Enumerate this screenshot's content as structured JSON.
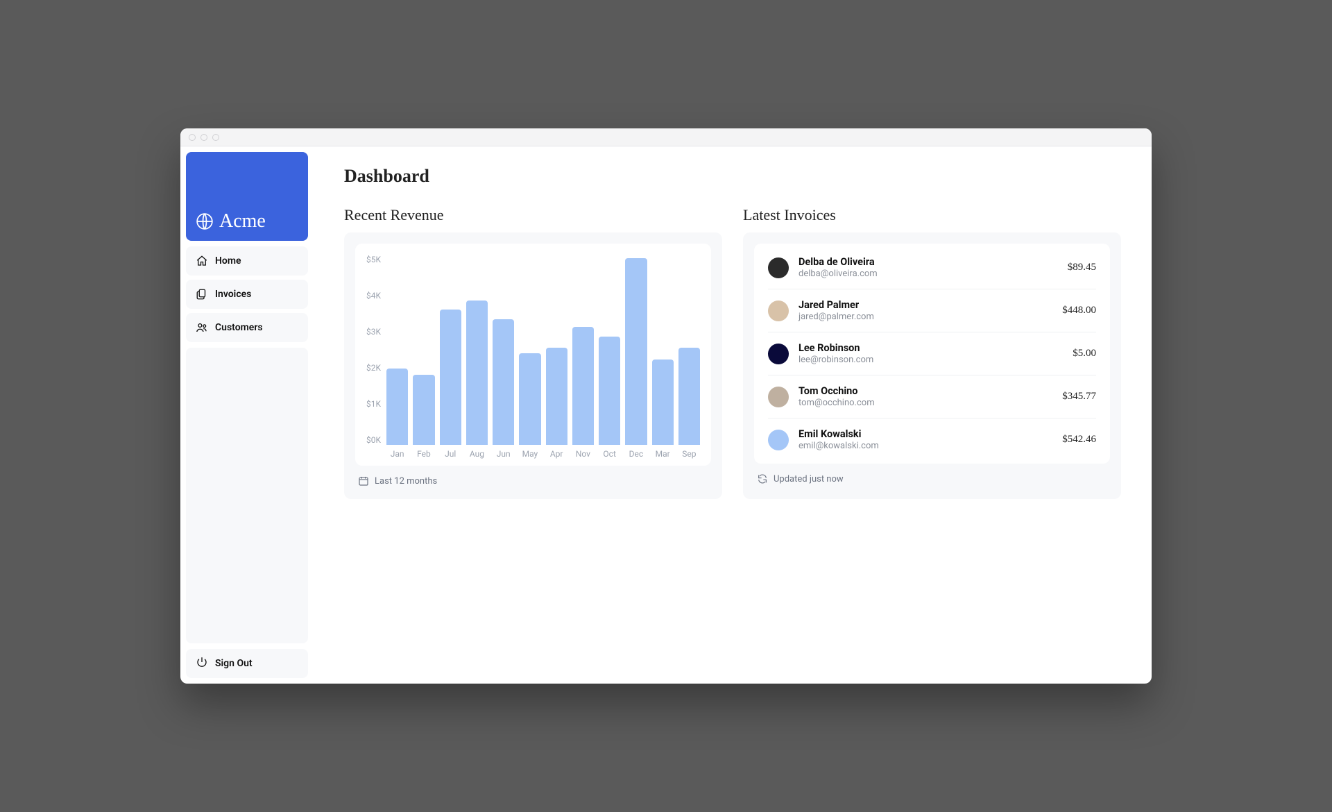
{
  "brand": {
    "name": "Acme"
  },
  "sidebar": {
    "items": [
      {
        "label": "Home"
      },
      {
        "label": "Invoices"
      },
      {
        "label": "Customers"
      }
    ],
    "signout_label": "Sign Out"
  },
  "page": {
    "title": "Dashboard"
  },
  "revenue": {
    "title": "Recent Revenue",
    "footer": "Last 12 months",
    "ylabels": [
      "$5K",
      "$4K",
      "$3K",
      "$2K",
      "$1K",
      "$0K"
    ]
  },
  "invoices": {
    "title": "Latest Invoices",
    "footer": "Updated just now",
    "items": [
      {
        "name": "Delba de Oliveira",
        "email": "delba@oliveira.com",
        "amount": "$89.45",
        "avatar_color": "#2b2b2b"
      },
      {
        "name": "Jared Palmer",
        "email": "jared@palmer.com",
        "amount": "$448.00",
        "avatar_color": "#d8c2a8"
      },
      {
        "name": "Lee Robinson",
        "email": "lee@robinson.com",
        "amount": "$5.00",
        "avatar_color": "#0a0a3a"
      },
      {
        "name": "Tom Occhino",
        "email": "tom@occhino.com",
        "amount": "$345.77",
        "avatar_color": "#bfb0a0"
      },
      {
        "name": "Emil Kowalski",
        "email": "emil@kowalski.com",
        "amount": "$542.46",
        "avatar_color": "#a4c6f7"
      }
    ]
  },
  "chart_data": {
    "type": "bar",
    "title": "Recent Revenue",
    "xlabel": "",
    "ylabel": "",
    "ylim": [
      0,
      5000
    ],
    "y_ticks": [
      0,
      1000,
      2000,
      3000,
      4000,
      5000
    ],
    "categories": [
      "Jan",
      "Feb",
      "Jul",
      "Aug",
      "Jun",
      "May",
      "Apr",
      "Nov",
      "Oct",
      "Dec",
      "Mar",
      "Sep"
    ],
    "values": [
      2000,
      1850,
      3550,
      3800,
      3300,
      2400,
      2550,
      3100,
      2850,
      4900,
      2250,
      2550
    ]
  }
}
